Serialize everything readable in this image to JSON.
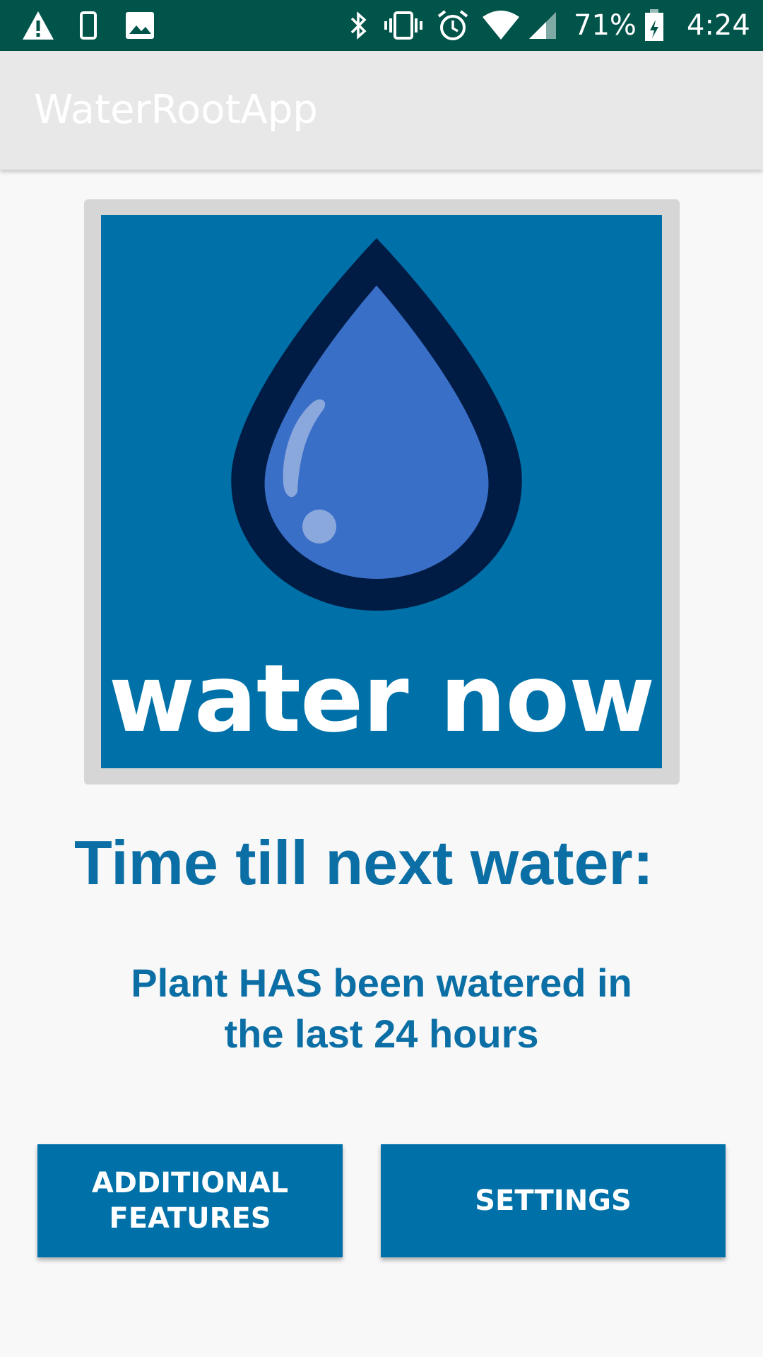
{
  "status_bar": {
    "battery_percent": "71%",
    "time": "4:24",
    "icons": [
      "warning-icon",
      "phone-icon",
      "image-icon",
      "bluetooth-icon",
      "vibrate-icon",
      "alarm-icon",
      "wifi-icon",
      "signal-icon",
      "battery-icon"
    ]
  },
  "app_bar": {
    "title": "WaterRootApp"
  },
  "water_button": {
    "label": "water now"
  },
  "main": {
    "heading": "Time till next water:",
    "status_message": "Plant HAS been watered in the last 24 hours"
  },
  "buttons": {
    "additional_features": "ADDITIONAL\nFEATURES",
    "settings": "SETTINGS"
  },
  "colors": {
    "status_bar": "#01544a",
    "app_bar": "#e8e8e8",
    "accent": "#0071a8",
    "text_accent": "#0b6fa5",
    "drop_outline": "#011c44",
    "drop_fill": "#3a6fc8",
    "drop_highlight": "#8aa8dc"
  }
}
